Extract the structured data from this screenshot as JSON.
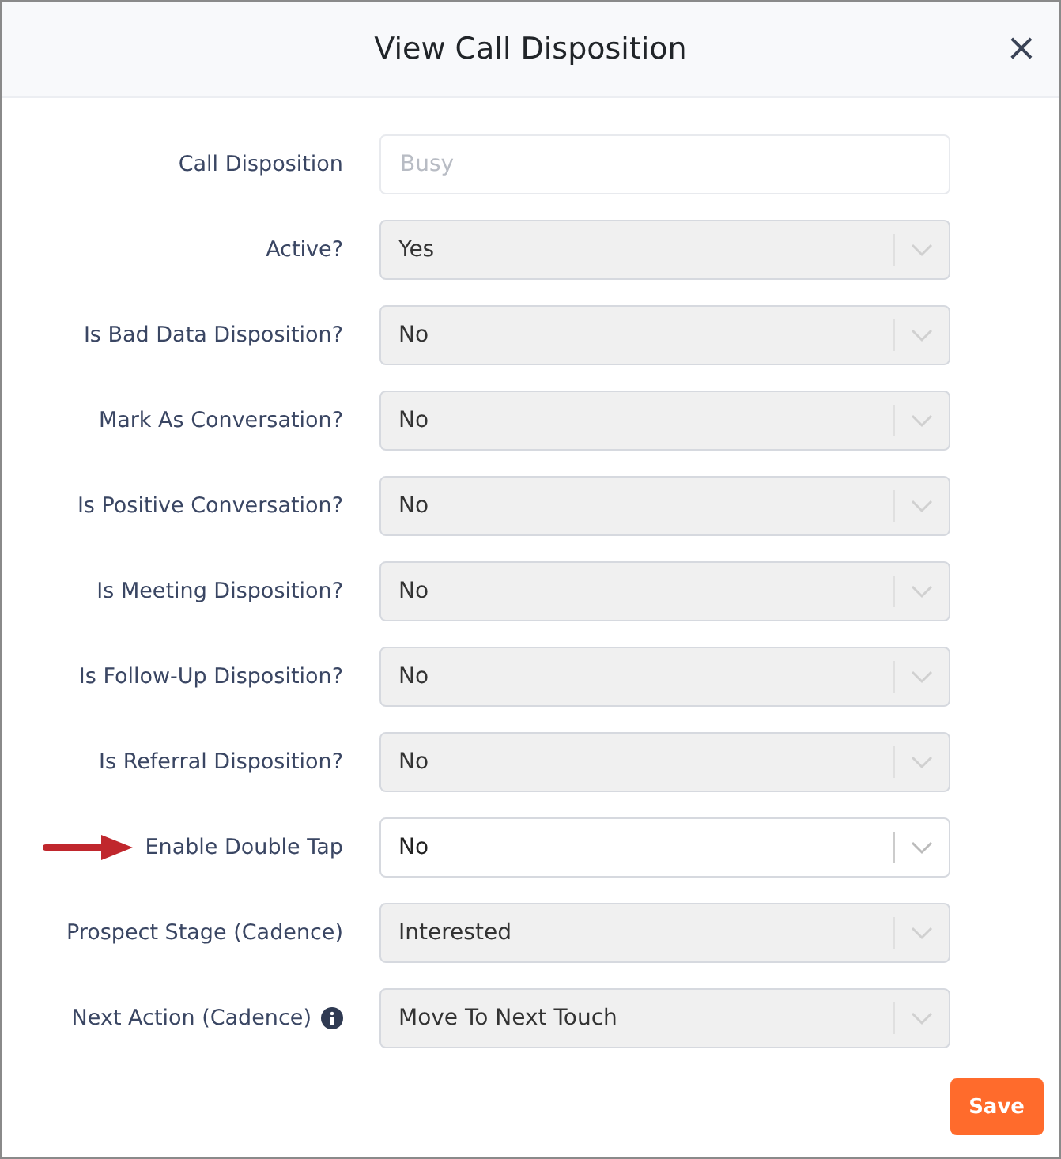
{
  "dialog": {
    "title": "View Call Disposition",
    "close": "×"
  },
  "fields": [
    {
      "label": "Call Disposition",
      "kind": "text",
      "placeholder": "Busy",
      "disabled": false,
      "arrow": false,
      "info": false
    },
    {
      "label": "Active?",
      "kind": "select",
      "value": "Yes",
      "disabled": true,
      "arrow": false,
      "info": false
    },
    {
      "label": "Is Bad Data Disposition?",
      "kind": "select",
      "value": "No",
      "disabled": true,
      "arrow": false,
      "info": false
    },
    {
      "label": "Mark As Conversation?",
      "kind": "select",
      "value": "No",
      "disabled": true,
      "arrow": false,
      "info": false
    },
    {
      "label": "Is Positive Conversation?",
      "kind": "select",
      "value": "No",
      "disabled": true,
      "arrow": false,
      "info": false
    },
    {
      "label": "Is Meeting Disposition?",
      "kind": "select",
      "value": "No",
      "disabled": true,
      "arrow": false,
      "info": false
    },
    {
      "label": "Is Follow-Up Disposition?",
      "kind": "select",
      "value": "No",
      "disabled": true,
      "arrow": false,
      "info": false
    },
    {
      "label": "Is Referral Disposition?",
      "kind": "select",
      "value": "No",
      "disabled": true,
      "arrow": false,
      "info": false
    },
    {
      "label": "Enable Double Tap",
      "kind": "select",
      "value": "No",
      "disabled": false,
      "arrow": true,
      "info": false
    },
    {
      "label": "Prospect Stage (Cadence)",
      "kind": "select",
      "value": "Interested",
      "disabled": true,
      "arrow": false,
      "info": false
    },
    {
      "label": "Next Action (Cadence)",
      "kind": "select",
      "value": "Move To Next Touch",
      "disabled": true,
      "arrow": false,
      "info": true
    }
  ],
  "save_button": "Save"
}
